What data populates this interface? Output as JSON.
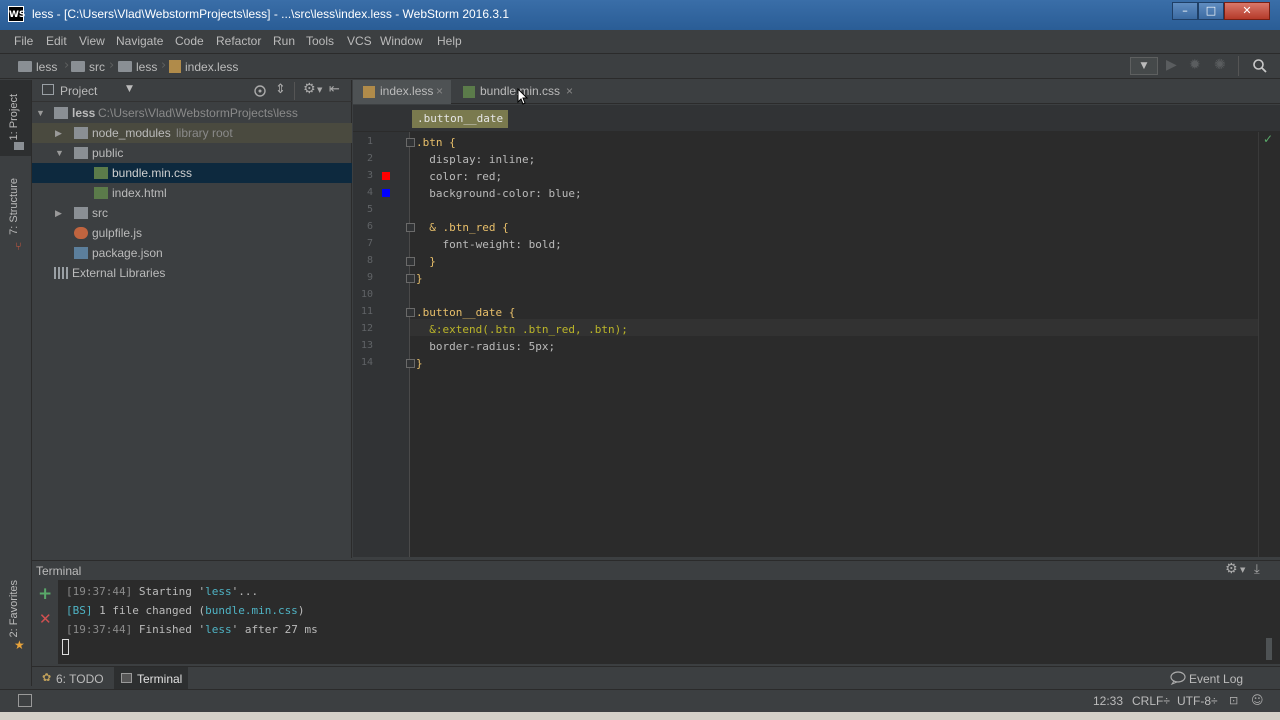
{
  "window": {
    "app_icon": "WS",
    "title": "less - [C:\\Users\\Vlad\\WebstormProjects\\less] - ...\\src\\less\\index.less - WebStorm 2016.3.1",
    "controls": {
      "minimize": "–",
      "maximize": "□",
      "close": "✕"
    }
  },
  "menu": [
    "File",
    "Edit",
    "View",
    "Navigate",
    "Code",
    "Refactor",
    "Run",
    "Tools",
    "VCS",
    "Window",
    "Help"
  ],
  "breadcrumb": [
    "less",
    "src",
    "less",
    "index.less"
  ],
  "left_strip": {
    "project": "1: Project",
    "structure": "7: Structure",
    "favorites": "2: Favorites"
  },
  "project_panel": {
    "view_label": "Project",
    "tree": [
      {
        "label": "less",
        "hint": "C:\\Users\\Vlad\\WebstormProjects\\less",
        "expanded": true
      },
      {
        "label": "node_modules",
        "hint": "library root",
        "expanded": false
      },
      {
        "label": "public",
        "expanded": true
      },
      {
        "label": "bundle.min.css",
        "selected": true
      },
      {
        "label": "index.html"
      },
      {
        "label": "src",
        "expanded": false
      },
      {
        "label": "gulpfile.js"
      },
      {
        "label": "package.json"
      },
      {
        "label": "External Libraries"
      }
    ]
  },
  "editor_tabs": [
    {
      "label": "index.less",
      "close": "×",
      "active": true
    },
    {
      "label": "bundle.min.css",
      "close": "×",
      "active": false
    }
  ],
  "structure_crumb": ".button__date",
  "code": {
    "line_numbers": [
      "1",
      "2",
      "3",
      "4",
      "5",
      "6",
      "7",
      "8",
      "9",
      "10",
      "11",
      "12",
      "13",
      "14"
    ],
    "lines": [
      ".btn {",
      "  display: inline;",
      "  color: red;",
      "  background-color: blue;",
      "",
      "  & .btn_red {",
      "    font-weight: bold;",
      "  }",
      "}",
      "",
      ".button__date {",
      "  &:extend(.btn .btn_red, .btn);",
      "  border-radius: 5px;",
      "}"
    ],
    "color_swatches": {
      "red": "#ff0000",
      "blue": "#0000ff"
    }
  },
  "terminal": {
    "title": "Terminal",
    "lines": [
      {
        "ts": "[19:37:44]",
        "text": " Starting '",
        "hl": "less",
        "tail": "'..."
      },
      {
        "ts": "[BS]",
        "text": " 1 file changed (",
        "hl": "bundle.min.css",
        "tail": ")"
      },
      {
        "ts": "[19:37:44]",
        "text": " Finished '",
        "hl": "less",
        "tail": "' after 27 ms"
      }
    ]
  },
  "tool_windows": {
    "todo": "6: TODO",
    "terminal": "Terminal",
    "event_log": "Event Log"
  },
  "status": {
    "position": "12:33",
    "line_sep": "CRLF÷",
    "encoding": "UTF-8÷"
  }
}
